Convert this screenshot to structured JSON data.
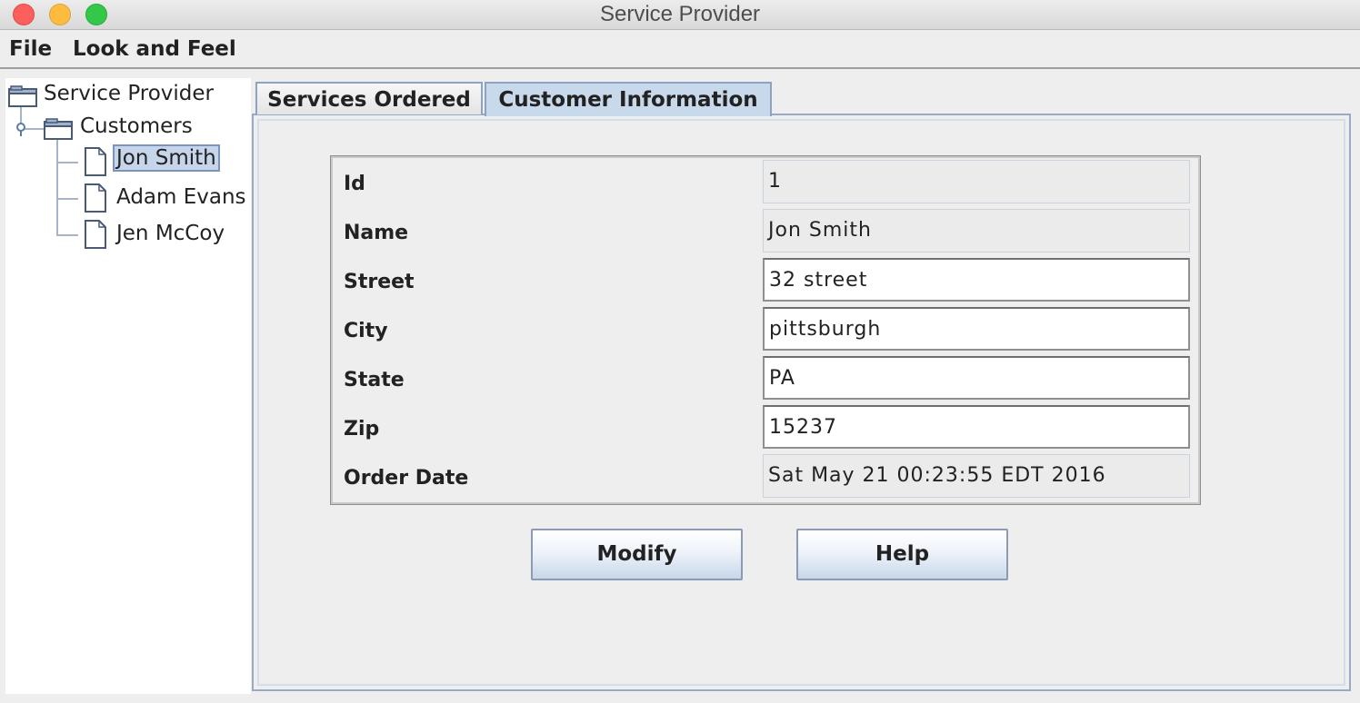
{
  "window": {
    "title": "Service Provider"
  },
  "menu": {
    "items": [
      "File",
      "Look and Feel"
    ]
  },
  "tree": {
    "root": "Service Provider",
    "group": "Customers",
    "customers": [
      "Jon Smith",
      "Adam Evans",
      "Jen McCoy"
    ],
    "selected": "Jon Smith"
  },
  "tabs": [
    {
      "label": "Services Ordered",
      "active": false
    },
    {
      "label": "Customer Information",
      "active": true
    }
  ],
  "form": {
    "id": {
      "label": "Id",
      "value": "1",
      "editable": false
    },
    "name": {
      "label": "Name",
      "value": "Jon Smith",
      "editable": false
    },
    "street": {
      "label": "Street",
      "value": "32 street",
      "editable": true
    },
    "city": {
      "label": "City",
      "value": "pittsburgh",
      "editable": true
    },
    "state": {
      "label": "State",
      "value": "PA",
      "editable": true
    },
    "zip": {
      "label": "Zip",
      "value": "15237",
      "editable": true
    },
    "orderdate": {
      "label": "Order Date",
      "value": "Sat May 21 00:23:55 EDT 2016",
      "editable": false
    }
  },
  "buttons": {
    "modify": "Modify",
    "help": "Help"
  },
  "colors": {
    "selection": "#c6d5ea",
    "tab_active": "#c9d9ec",
    "close": "#fc605c",
    "minimize": "#fdbc40",
    "maximize": "#34c84a"
  },
  "icons": [
    "close-icon",
    "minimize-icon",
    "maximize-icon",
    "folder-icon",
    "tree-expand-handle-icon",
    "document-icon"
  ]
}
